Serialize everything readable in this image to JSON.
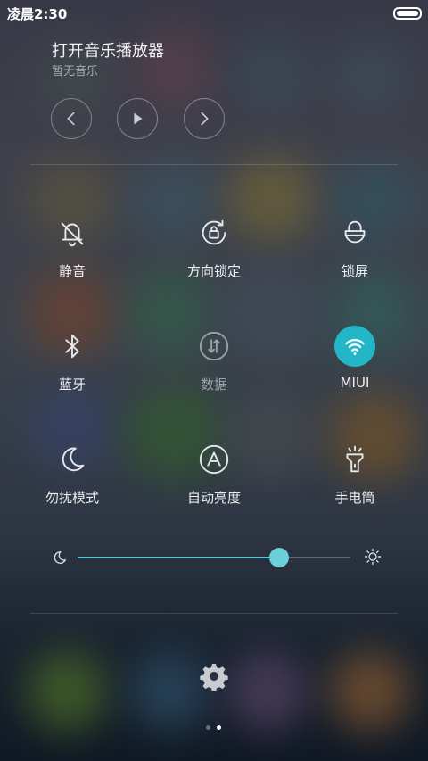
{
  "status_bar": {
    "time": "凌晨2:30",
    "battery_level": 1.0
  },
  "music": {
    "title": "打开音乐播放器",
    "subtitle": "暂无音乐",
    "controls": [
      "previous-icon",
      "play-icon",
      "next-icon"
    ]
  },
  "toggles": [
    {
      "id": "mute",
      "label": "静音",
      "icon": "bell-off-icon",
      "state": "off"
    },
    {
      "id": "rotation-lock",
      "label": "方向锁定",
      "icon": "rotation-lock-icon",
      "state": "off"
    },
    {
      "id": "lock-screen",
      "label": "锁屏",
      "icon": "lock-icon",
      "state": "off"
    },
    {
      "id": "bluetooth",
      "label": "蓝牙",
      "icon": "bluetooth-icon",
      "state": "off"
    },
    {
      "id": "data",
      "label": "数据",
      "icon": "mobile-data-icon",
      "state": "disabled"
    },
    {
      "id": "wifi",
      "label": "MIUI",
      "icon": "wifi-icon",
      "state": "on"
    },
    {
      "id": "do-not-disturb",
      "label": "勿扰模式",
      "icon": "moon-icon",
      "state": "off"
    },
    {
      "id": "auto-brightness",
      "label": "自动亮度",
      "icon": "auto-brightness-icon",
      "state": "off"
    },
    {
      "id": "flashlight",
      "label": "手电筒",
      "icon": "flashlight-icon",
      "state": "off"
    }
  ],
  "brightness": {
    "level": 0.74,
    "low_icon": "moon-small-icon",
    "high_icon": "sun-icon"
  },
  "settings_icon": "gear-icon",
  "pager": {
    "pages": 2,
    "current": 2
  },
  "colors": {
    "accent": "#23b6c7",
    "slider_fill": "#58c6d3",
    "knob": "#6cd0db"
  }
}
